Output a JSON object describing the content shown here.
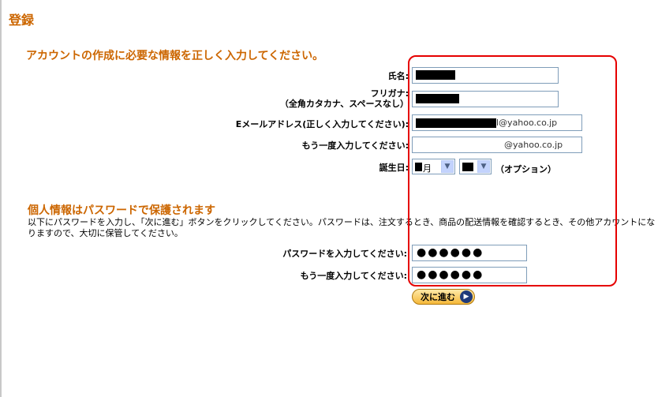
{
  "page": {
    "title": "登録"
  },
  "account_section": {
    "heading": "アカウントの作成に必要な情報を正しく入力してください。",
    "name_label": "氏名:",
    "furigana_label_line1": "フリガナ:",
    "furigana_label_line2": "（全角カタカナ、スペースなし）",
    "email_label": "Eメールアドレス(正しく入力してください):",
    "email_suffix": "l@yahoo.co.jp",
    "email_confirm_label": "もう一度入力してください:",
    "email_confirm_suffix": "@yahoo.co.jp",
    "birthday_label": "誕生日:",
    "month_value": "月",
    "day_value": "",
    "optional_text": "（オプション）"
  },
  "password_section": {
    "heading": "個人情報はパスワードで保護されます",
    "description": "以下にパスワードを入力し、「次に進む」ボタンをクリックしてください。パスワードは、注文するとき、商品の配送情報を確認するとき、その他アカウントになりますので、大切に保管してください。",
    "password_label": "パスワードを入力してください:",
    "password_value": "●●●●●●",
    "password_confirm_label": "もう一度入力してください:",
    "password_confirm_value": "●●●●●●"
  },
  "actions": {
    "next_label": "次に進む"
  },
  "icons": {
    "dropdown": "triangle-down-icon",
    "next": "arrow-right-circle-icon"
  },
  "colors": {
    "heading": "#cc6600",
    "highlight": "#e60000",
    "field_border": "#7f9db9"
  }
}
